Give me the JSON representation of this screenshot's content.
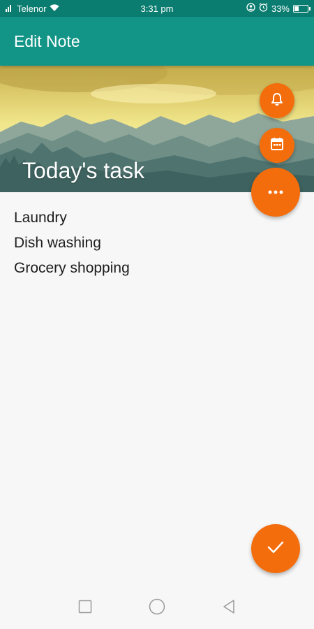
{
  "status_bar": {
    "carrier": "Telenor",
    "time": "3:31 pm",
    "battery_percent": "33%",
    "battery_level": 0.33,
    "icons": [
      "signal-icon",
      "wifi-icon",
      "location-icon",
      "alarm-icon",
      "battery-icon"
    ]
  },
  "app_bar": {
    "title": "Edit Note",
    "color": "#129486"
  },
  "note": {
    "title": "Today's task",
    "lines": [
      "Laundry",
      "Dish washing",
      "Grocery shopping"
    ]
  },
  "fabs": {
    "color": "#f46d0c",
    "icons": [
      "bell-icon",
      "calendar-icon",
      "more-icon",
      "check-icon"
    ]
  },
  "nav_bar": {
    "icons": [
      "recent-apps-icon",
      "home-icon",
      "back-icon"
    ]
  }
}
